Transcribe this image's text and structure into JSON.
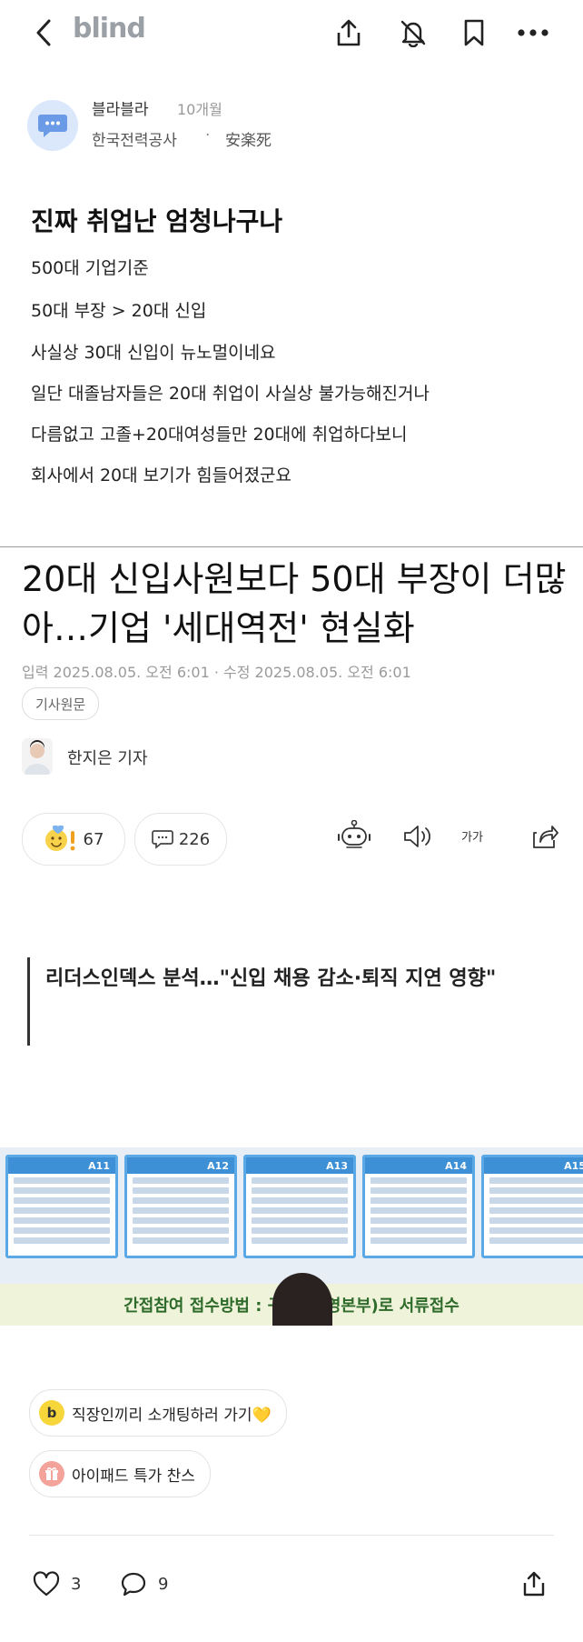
{
  "header": {
    "logo": "blind",
    "icons": [
      "back-icon",
      "share-icon",
      "notification-off-icon",
      "bookmark-icon",
      "more-icon"
    ]
  },
  "post": {
    "author": "블라블라",
    "time_ago": "10개월",
    "company": "한국전력공사",
    "separator": "·",
    "nickname": "安楽死",
    "title": "진짜 취업난 엄청나구나",
    "lines": [
      "500대 기업기준",
      "50대 부장 > 20대 신입",
      "사실상 30대 신입이 뉴노멀이네요",
      "일단 대졸남자들은 20대 취업이 사실상 불가능해진거나",
      "다름없고 고졸+20대여성들만 20대에 취업하다보니",
      "회사에서 20대 보기가 힘들어졌군요"
    ]
  },
  "article": {
    "headline": "20대 신입사원보다 50대 부장이 더많아…기업 '세대역전' 현실화",
    "dates": "입력 2025.08.05. 오전 6:01 · 수정 2025.08.05. 오전 6:01",
    "source_chip": "기사원문",
    "reporter": "한지은 기자",
    "reaction_count": "67",
    "comment_count": "226",
    "font_size_label": "가가",
    "subheading": "리더스인덱스 분석…\"신입 채용 감소·퇴직 지연 영향\"",
    "photo": {
      "booths": [
        "A11",
        "A12",
        "A13",
        "A14",
        "A15"
      ],
      "banner": "간접참여 접수방법 : 구직                (운영본부)로 서류접수"
    }
  },
  "promos": [
    {
      "badge": "b",
      "label": "직장인끼리 소개팅하러 가기💛"
    },
    {
      "badge": "gift-icon",
      "label": "아이패드 특가 찬스"
    }
  ],
  "footer": {
    "like_count": "3",
    "comment_count": "9"
  }
}
